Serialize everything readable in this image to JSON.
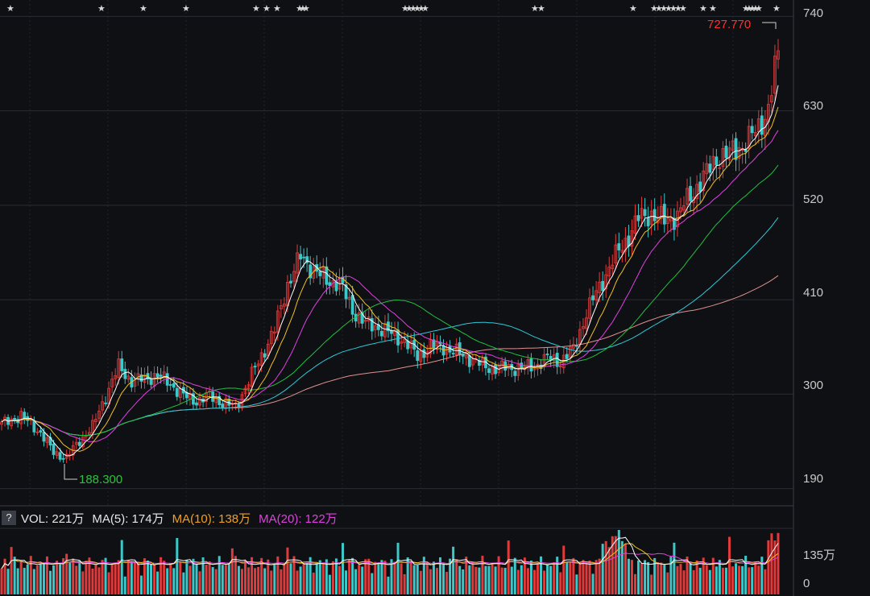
{
  "chart_data": {
    "type": "candlestick",
    "y_ticks": [
      "740",
      "630",
      "520",
      "410",
      "300",
      "190"
    ],
    "y_range": [
      170,
      745
    ],
    "high_label": "727.770",
    "low_label": "188.300",
    "price_anchors": [
      [
        0,
        265
      ],
      [
        6,
        275
      ],
      [
        12,
        255
      ],
      [
        16,
        232
      ],
      [
        20,
        226
      ],
      [
        24,
        246
      ],
      [
        28,
        262
      ],
      [
        32,
        298
      ],
      [
        36,
        332
      ],
      [
        40,
        315
      ],
      [
        44,
        318
      ],
      [
        48,
        322
      ],
      [
        52,
        312
      ],
      [
        56,
        298
      ],
      [
        60,
        292
      ],
      [
        64,
        298
      ],
      [
        68,
        290
      ],
      [
        72,
        285
      ],
      [
        76,
        315
      ],
      [
        80,
        345
      ],
      [
        84,
        375
      ],
      [
        88,
        428
      ],
      [
        92,
        460
      ],
      [
        96,
        445
      ],
      [
        100,
        432
      ],
      [
        104,
        430
      ],
      [
        108,
        398
      ],
      [
        112,
        382
      ],
      [
        116,
        378
      ],
      [
        120,
        370
      ],
      [
        124,
        362
      ],
      [
        128,
        344
      ],
      [
        132,
        356
      ],
      [
        136,
        355
      ],
      [
        140,
        348
      ],
      [
        144,
        342
      ],
      [
        148,
        333
      ],
      [
        152,
        330
      ],
      [
        156,
        331
      ],
      [
        160,
        330
      ],
      [
        164,
        333
      ],
      [
        168,
        342
      ],
      [
        172,
        338
      ],
      [
        176,
        352
      ],
      [
        180,
        395
      ],
      [
        184,
        425
      ],
      [
        188,
        455
      ],
      [
        192,
        478
      ],
      [
        196,
        505
      ],
      [
        200,
        510
      ],
      [
        204,
        502
      ],
      [
        208,
        508
      ],
      [
        212,
        532
      ],
      [
        216,
        552
      ],
      [
        220,
        575
      ],
      [
        224,
        580
      ],
      [
        228,
        590
      ],
      [
        232,
        605
      ],
      [
        236,
        632
      ],
      [
        239,
        700
      ]
    ],
    "volume": {
      "vol_label": "VOL: 221万",
      "ma5_label": "MA(5): 174万",
      "ma10_label": "MA(10): 138万",
      "ma20_label": "MA(20): 122万",
      "y_ticks": [
        "135万",
        "0"
      ]
    },
    "colors": {
      "up": "#e03a3a",
      "down": "#3cc8c8",
      "ma5": "#ffffff",
      "ma10": "#f0c020",
      "ma20": "#e040e0",
      "ma60": "#20c040",
      "ma120": "#30c8d8",
      "ma250": "#e09090",
      "high": "#ff3030",
      "low": "#30c040"
    },
    "star_markers": true
  }
}
